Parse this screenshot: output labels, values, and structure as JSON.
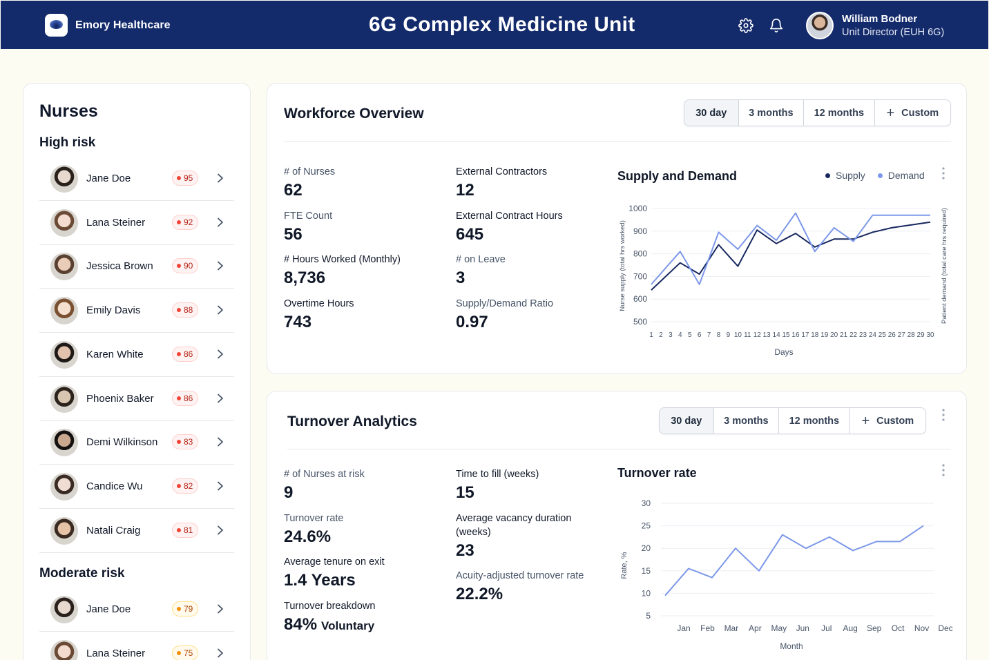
{
  "header": {
    "brand": "Emory Healthcare",
    "title": "6G Complex Medicine Unit",
    "user_name": "William Bodner",
    "user_role": "Unit Director (EUH 6G)"
  },
  "nurses": {
    "title": "Nurses",
    "high_heading": "High risk",
    "moderate_heading": "Moderate risk",
    "high": [
      {
        "name": "Jane Doe",
        "score": "95"
      },
      {
        "name": "Lana Steiner",
        "score": "92"
      },
      {
        "name": "Jessica Brown",
        "score": "90"
      },
      {
        "name": "Emily Davis",
        "score": "88"
      },
      {
        "name": "Karen White",
        "score": "86"
      },
      {
        "name": "Phoenix Baker",
        "score": "86"
      },
      {
        "name": "Demi Wilkinson",
        "score": "83"
      },
      {
        "name": "Candice Wu",
        "score": "82"
      },
      {
        "name": "Natali Craig",
        "score": "81"
      }
    ],
    "moderate": [
      {
        "name": "Jane Doe",
        "score": "79"
      },
      {
        "name": "Lana Steiner",
        "score": "75"
      }
    ]
  },
  "range_tabs": [
    "30 day",
    "3 months",
    "12 months",
    "Custom"
  ],
  "workforce": {
    "title": "Workforce Overview",
    "metrics_left": [
      {
        "label": "# of Nurses",
        "value": "62"
      },
      {
        "label": "FTE Count",
        "value": "56"
      },
      {
        "label": "# Hours Worked (Monthly)",
        "value": "8,736"
      },
      {
        "label": "Overtime Hours",
        "value": "743"
      }
    ],
    "metrics_right": [
      {
        "label": "External Contractors",
        "value": "12"
      },
      {
        "label": "External Contract Hours",
        "value": "645"
      },
      {
        "label": "# on Leave",
        "value": "3"
      },
      {
        "label": "Supply/Demand Ratio",
        "value": "0.97"
      }
    ]
  },
  "turnover": {
    "title": "Turnover Analytics",
    "metrics_left": [
      {
        "label": "# of Nurses at risk",
        "value": "9"
      },
      {
        "label": "Turnover rate",
        "value": "24.6%"
      },
      {
        "label": "Average tenure on exit",
        "value": "1.4 Years"
      },
      {
        "label": "Turnover breakdown",
        "value": "84%",
        "suffix": "Voluntary"
      }
    ],
    "metrics_right": [
      {
        "label": "Time to fill (weeks)",
        "value": "15"
      },
      {
        "label": "Average vacancy duration",
        "label2": "(weeks)",
        "value": "23"
      },
      {
        "label": "Acuity-adjusted turnover rate",
        "value": "22.2%"
      }
    ]
  },
  "colors": {
    "supply": "#16275e",
    "demand": "#7b97e8",
    "header_bg": "#132a6b"
  },
  "chart_data": [
    {
      "type": "line",
      "title": "Supply and Demand",
      "xlabel": "Days",
      "ylabel": "Nurse supply (total hrs worked)",
      "ylabel_right": "Patient demand (total care hrs required)",
      "ylim": [
        500,
        1000
      ],
      "yticks": [
        500,
        600,
        700,
        800,
        900,
        1000
      ],
      "legend": "top-right",
      "grid": true,
      "x": [
        1,
        2,
        3,
        4,
        5,
        6,
        7,
        8,
        9,
        10,
        11,
        12,
        13,
        14,
        15,
        16,
        17,
        18,
        19,
        20,
        21,
        22,
        23,
        24,
        25,
        26,
        27,
        28,
        29,
        30
      ],
      "x_samples": [
        1,
        4.5,
        7,
        10,
        14,
        18,
        21,
        24,
        27,
        30
      ],
      "series": [
        {
          "name": "Supply",
          "values": [
            640,
            760,
            710,
            840,
            745,
            905,
            845,
            890,
            830,
            865,
            865,
            895,
            915,
            940
          ]
        },
        {
          "name": "Demand",
          "values": [
            665,
            810,
            665,
            895,
            820,
            925,
            860,
            980,
            810,
            915,
            855,
            970,
            970,
            970
          ]
        }
      ],
      "x_positions_note_series": "values sampled at days 1,4,6,8,10,12,14,16,18,20,22,24,26,30"
    },
    {
      "type": "line",
      "title": "Turnover rate",
      "xlabel": "Month",
      "ylabel": "Rate, %",
      "ylim": [
        5,
        30
      ],
      "yticks": [
        5,
        10,
        15,
        20,
        25,
        30
      ],
      "grid": true,
      "categories": [
        "Jan",
        "Feb",
        "Mar",
        "Apr",
        "May",
        "Jun",
        "Jul",
        "Aug",
        "Sep",
        "Oct",
        "Nov",
        "Dec"
      ],
      "series": [
        {
          "name": "Turnover rate",
          "values": [
            9.5,
            15.5,
            13.5,
            20,
            15,
            23,
            20,
            22.5,
            19.5,
            21.5,
            21.5,
            25
          ]
        }
      ]
    }
  ]
}
